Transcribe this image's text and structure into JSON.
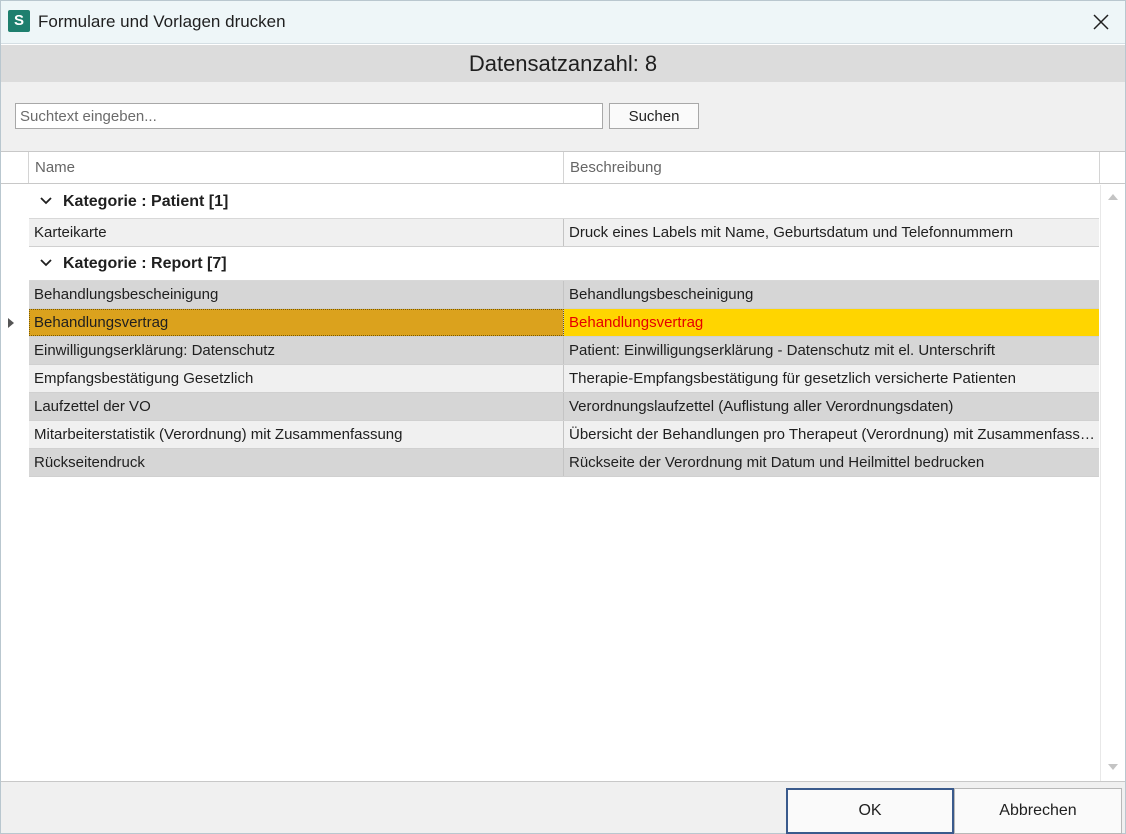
{
  "window": {
    "icon_letter": "S",
    "title": "Formulare und Vorlagen drucken",
    "close_glyph": "✕"
  },
  "header": {
    "record_count": "Datensatzanzahl: 8"
  },
  "search": {
    "placeholder": "Suchtext eingeben...",
    "value": "",
    "button_label": "Suchen"
  },
  "grid": {
    "columns": [
      "Name",
      "Beschreibung"
    ],
    "groups": [
      {
        "label": "Kategorie : Patient [1]",
        "rows": [
          {
            "name": "Karteikarte",
            "description": "Druck eines Labels mit Name, Geburtsdatum und Telefonnummern"
          }
        ]
      },
      {
        "label": "Kategorie : Report [7]",
        "rows": [
          {
            "name": "Behandlungsbescheinigung",
            "description": "Behandlungsbescheinigung"
          },
          {
            "name": "Behandlungsvertrag",
            "description": "Behandlungsvertrag",
            "selected": true
          },
          {
            "name": "Einwilligungserklärung: Datenschutz",
            "description": "Patient: Einwilligungserklärung - Datenschutz mit el. Unterschrift"
          },
          {
            "name": "Empfangsbestätigung Gesetzlich",
            "description": "Therapie-Empfangsbestätigung für gesetzlich versicherte Patienten"
          },
          {
            "name": "Laufzettel der VO",
            "description": "Verordnungslaufzettel (Auflistung aller Verordnungsdaten)"
          },
          {
            "name": "Mitarbeiterstatistik (Verordnung) mit Zusammenfassung",
            "description": "Übersicht der Behandlungen pro Therapeut (Verordnung) mit Zusammenfassung"
          },
          {
            "name": "Rückseitendruck",
            "description": "Rückseite der Verordnung mit Datum und Heilmittel bedrucken"
          }
        ]
      }
    ]
  },
  "footer": {
    "ok_label": "OK",
    "cancel_label": "Abbrechen"
  },
  "colors": {
    "app_icon": "#1e7f6e",
    "selected_name_bg": "#dba21d",
    "selected_desc_bg": "#ffd500",
    "selected_desc_text": "#e60000",
    "ok_border": "#3a5a8c"
  },
  "icons": {
    "close": "close-icon",
    "group_toggle": "chevron-down-icon",
    "row_indicator": "triangle-right-icon",
    "scroll_up": "arrow-up-icon",
    "scroll_down": "arrow-down-icon"
  }
}
